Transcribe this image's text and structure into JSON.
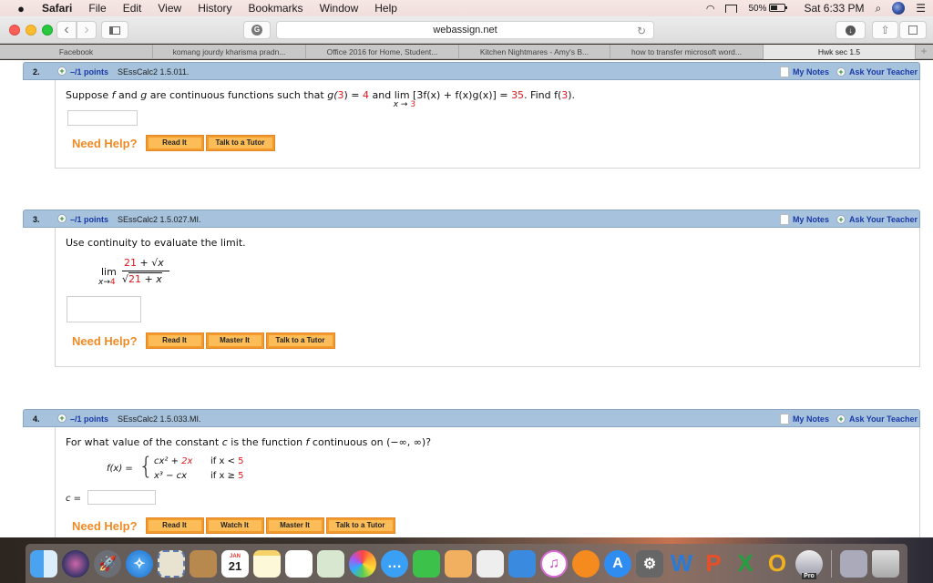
{
  "menubar": {
    "app_name": "Safari",
    "items": [
      "File",
      "Edit",
      "View",
      "History",
      "Bookmarks",
      "Window",
      "Help"
    ],
    "battery": "50%",
    "clock": "Sat 6:33 PM"
  },
  "toolbar": {
    "address": "webassign.net",
    "back_glyph": "‹",
    "forward_glyph": "›",
    "reload_glyph": "↻"
  },
  "tabs": [
    {
      "label": "Facebook",
      "active": false
    },
    {
      "label": "komang jourdy kharisma pradn...",
      "active": false
    },
    {
      "label": "Office 2016 for Home, Student...",
      "active": false
    },
    {
      "label": "Kitchen Nightmares - Amy's B...",
      "active": false
    },
    {
      "label": "how to transfer microsoft word...",
      "active": false
    },
    {
      "label": "Hwk sec 1.5",
      "active": true
    }
  ],
  "tab_add": "+",
  "shared": {
    "my_notes": "My Notes",
    "ask_teacher": "Ask Your Teacher",
    "need_help": "Need Help?",
    "plus": "+"
  },
  "questions": [
    {
      "number": "2.",
      "points": "–/1 points",
      "code": "SEssCalc2 1.5.011.",
      "text": {
        "p1": "Suppose ",
        "f": "f",
        "p2": " and ",
        "g": "g",
        "p3": " are continuous functions such that  ",
        "g3": "g(",
        "three": "3",
        "close_eq": ") = ",
        "gval": "4",
        "and": "  and  ",
        "lim": "lim",
        "lim_sub": "x → ",
        "lim_sub_val": "3",
        "expr": " [3f(x) + f(x)g(x)] = ",
        "limval": "35",
        "find": ".  Find  f(",
        "find_val": "3",
        "find_end": ")."
      },
      "buttons": [
        "Read It",
        "Talk to a Tutor"
      ]
    },
    {
      "number": "3.",
      "points": "–/1 points",
      "code": "SEssCalc2 1.5.027.MI.",
      "text": {
        "prompt": "Use continuity to evaluate the limit.",
        "lim": "lim",
        "lim_sub": "x→",
        "lim_sub_val": "4",
        "num_const": "21",
        "num_rest": " + √x",
        "den_sqrt": "√",
        "den_const": "21",
        "den_rest": " + x"
      },
      "buttons": [
        "Read It",
        "Master It",
        "Talk to a Tutor"
      ]
    },
    {
      "number": "4.",
      "points": "–/1 points",
      "code": "SEssCalc2 1.5.033.MI.",
      "text": {
        "prompt_a": "For what value of the constant ",
        "c": "c",
        "prompt_b": " is the function ",
        "f": "f",
        "prompt_c": " continuous on (−∞, ∞)?",
        "fx": "f(x) = ",
        "brace": "{",
        "case1_a": "cx² + ",
        "case1_b": "2x",
        "case1_cond": "if x < ",
        "case1_val": "5",
        "case2": "x³ − cx",
        "case2_cond": "if x ≥ ",
        "case2_val": "5",
        "answer_label": "c ="
      },
      "buttons": [
        "Read It",
        "Watch It",
        "Master It",
        "Talk to a Tutor"
      ]
    }
  ],
  "dock": {
    "apps": [
      "Finder",
      "Siri",
      "Launchpad",
      "Safari",
      "Mail",
      "Contacts",
      "Calendar",
      "Notes",
      "Reminders",
      "Maps",
      "Photos",
      "Messages",
      "FaceTime",
      "Pages",
      "Numbers",
      "Keynote",
      "iTunes",
      "iBooks",
      "App Store",
      "System Preferences",
      "Word",
      "PowerPoint",
      "Excel",
      "Outlook",
      "Google Earth Pro",
      "Downloads",
      "Trash"
    ],
    "calendar_month": "JAN",
    "calendar_day": "21",
    "earth_badge": "Pro"
  }
}
